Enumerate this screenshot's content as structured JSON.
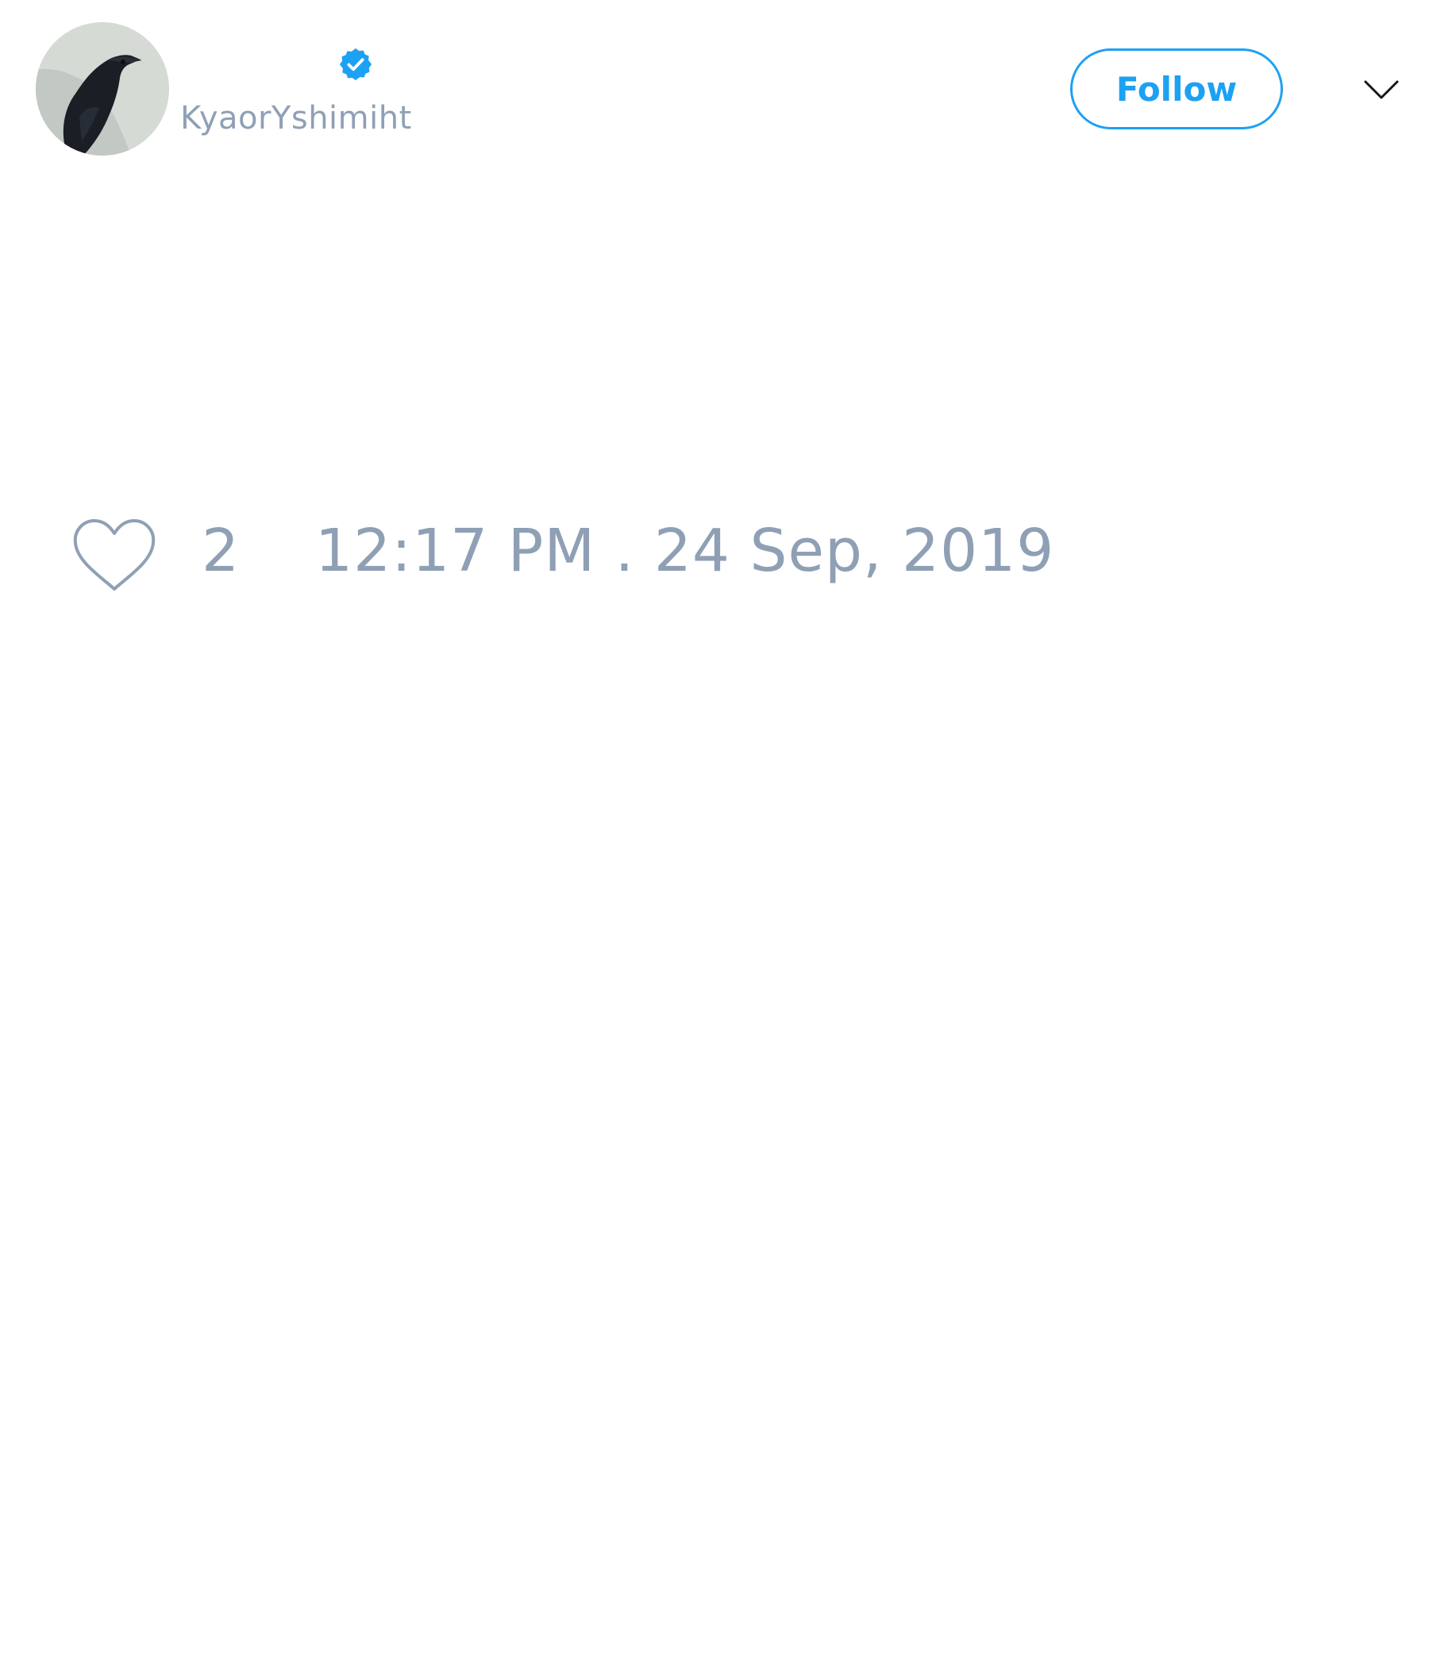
{
  "tweet": {
    "author": {
      "handle": "KyaorYshimiht",
      "verified": true,
      "avatar": "crow-avatar"
    },
    "follow_label": "Follow",
    "menu_icon": "chevron-down-icon",
    "likes": {
      "icon": "heart-outline-icon",
      "count": "2"
    },
    "timestamp": "12:17 PM . 24 Sep, 2019"
  },
  "colors": {
    "accent": "#1da1f2",
    "muted_text": "#8fa0b5",
    "background": "#ffffff"
  }
}
